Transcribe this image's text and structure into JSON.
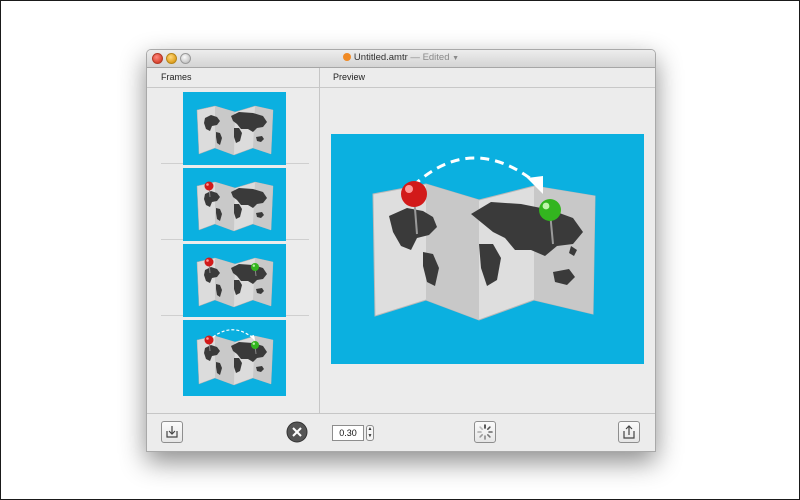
{
  "window": {
    "title": "Untitled.amtr",
    "edited": "Edited"
  },
  "panels": {
    "frames_header": "Frames",
    "preview_header": "Preview"
  },
  "frames": [
    {
      "index": 1,
      "pins": "none",
      "arrow": false
    },
    {
      "index": 2,
      "pins": "red",
      "arrow": false
    },
    {
      "index": 3,
      "pins": "red+green",
      "arrow": false
    },
    {
      "index": 4,
      "pins": "red+green",
      "arrow": true
    }
  ],
  "toolbar": {
    "duration_value": "0.30",
    "icons": {
      "import": "import-icon",
      "remove": "remove-icon",
      "spinner": "spinner-icon",
      "export": "share-icon"
    }
  },
  "colors": {
    "preview_bg": "#0bb0e0",
    "pin_red": "#d21a1a",
    "pin_green": "#33b51f",
    "map_gray": "#d8d8d8",
    "land_dark": "#3a3a3a"
  }
}
